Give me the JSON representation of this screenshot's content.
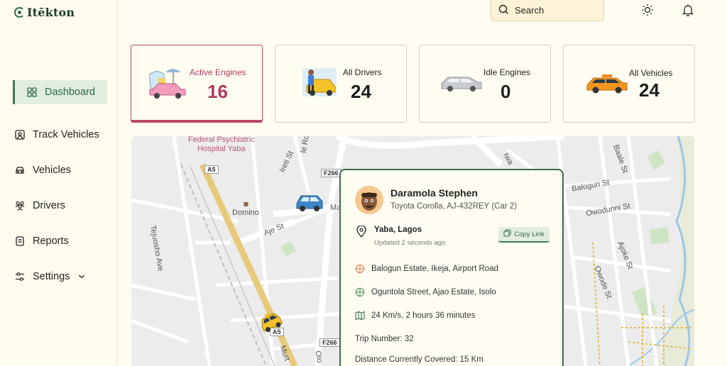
{
  "app": {
    "logo_text": "Itēkton"
  },
  "search": {
    "placeholder": "Search"
  },
  "sidebar": {
    "items": [
      {
        "label": "Dashboard",
        "icon": "grid-icon"
      },
      {
        "label": "Track Vehicles",
        "icon": "map-icon"
      },
      {
        "label": "Vehicles",
        "icon": "car-icon"
      },
      {
        "label": "Drivers",
        "icon": "people-icon"
      },
      {
        "label": "Reports",
        "icon": "report-icon"
      },
      {
        "label": "Settings",
        "icon": "settings-icon"
      }
    ]
  },
  "stats": [
    {
      "label": "Active Engines",
      "value": "16"
    },
    {
      "label": "All Drivers",
      "value": "24"
    },
    {
      "label": "Idle Engines",
      "value": "0"
    },
    {
      "label": "All Vehicles",
      "value": "24"
    }
  ],
  "map": {
    "labels": {
      "psychiatric": "Federal Psychiatric\nHospital Yaba",
      "domino": "Domino",
      "ireti": "Ireti St",
      "aje": "Aje St",
      "tejuosho": "Tejuosho Ave",
      "balogun": "Balogun St",
      "owodunni": "Owodunni St",
      "ajoke": "Ajoke St",
      "owode": "Owode St",
      "baale": "Baale St",
      "ma": "Ma",
      "murt": "Murt",
      "olo": "Olo",
      "le_rd": "le Rd",
      "iwa": "Iwa"
    },
    "shields": {
      "a5_top": "A5",
      "a5_bottom": "A5",
      "f266_top": "F266",
      "f266_bottom": "F266"
    }
  },
  "popup": {
    "driver_name": "Daramola Stephen",
    "vehicle": "Toyota Corolla, AJ-432REY (Car 2)",
    "location": "Yaba, Lagos",
    "updated": "Updated 2 seconds ago",
    "copy_label": "Copy Link",
    "origin": "Balogun Estate, Ikeja, Airport Road",
    "destination": "Oguntola Street, Ajao Estate, Isolo",
    "speed": "24 Km/s, 2 hours 36 minutes",
    "trip": "Trip Number: 32",
    "distance": "Distance Currently Covered: 15 Km"
  },
  "colors": {
    "accent": "#3b7a57",
    "active_card": "#b74a6b",
    "background": "#fffcf2"
  }
}
